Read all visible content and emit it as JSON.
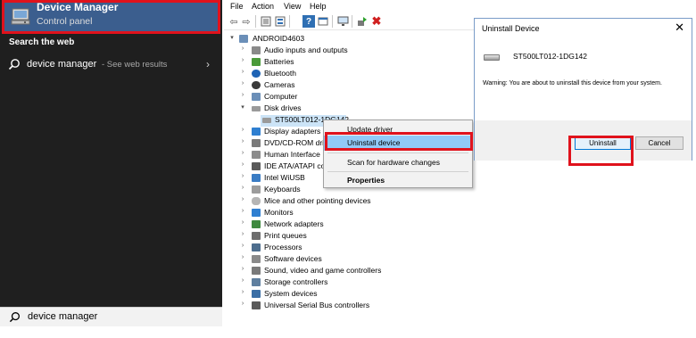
{
  "start_menu": {
    "best_match": {
      "title": "Device Manager",
      "subtitle": "Control panel",
      "icon": "device-manager-icon"
    },
    "section_label": "Search the web",
    "web_result": {
      "query": "device manager",
      "hint": "- See web results"
    },
    "search_box_value": "device manager"
  },
  "device_manager": {
    "menu": [
      "File",
      "Action",
      "View",
      "Help"
    ],
    "tree": {
      "root": "ANDROID4603",
      "items": [
        "Audio inputs and outputs",
        "Batteries",
        "Bluetooth",
        "Cameras",
        "Computer",
        "Disk drives",
        "ST500LT012-1DG142",
        "Display adapters",
        "DVD/CD-ROM dri",
        "Human Interface I",
        "IDE ATA/ATAPI co",
        "Intel WiUSB",
        "Keyboards",
        "Mice and other pointing devices",
        "Monitors",
        "Network adapters",
        "Print queues",
        "Processors",
        "Software devices",
        "Sound, video and game controllers",
        "Storage controllers",
        "System devices",
        "Universal Serial Bus controllers"
      ]
    },
    "context_menu": {
      "update_driver": "Update driver",
      "uninstall_device": "Uninstall device",
      "scan": "Scan for hardware changes",
      "properties": "Properties"
    }
  },
  "dialog": {
    "title": "Uninstall Device",
    "device_name": "ST500LT012-1DG142",
    "warning": "Warning: You are about to uninstall this device from your system.",
    "uninstall_label": "Uninstall",
    "cancel_label": "Cancel"
  },
  "colors": {
    "highlight_frame": "#e0121c",
    "start_menu_bg": "#1f1f1f",
    "best_match_bg": "#3b5e8e",
    "context_highlight": "#91c9f7"
  }
}
